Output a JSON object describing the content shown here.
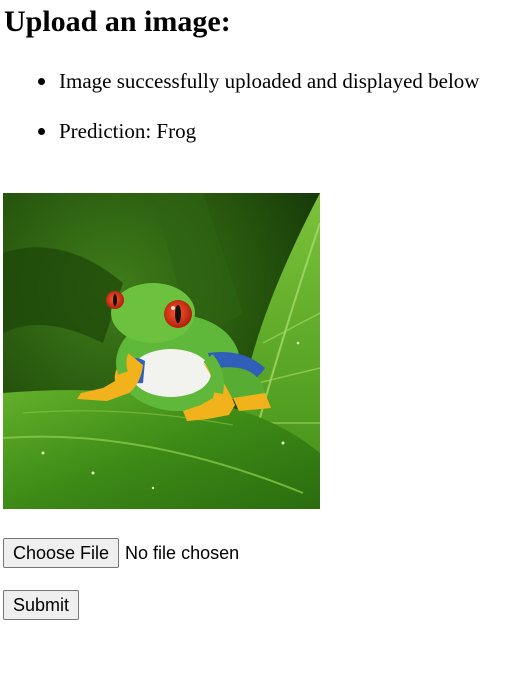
{
  "page": {
    "heading": "Upload an image:"
  },
  "messages": [
    "Image successfully uploaded and displayed below",
    "Prediction: Frog"
  ],
  "image": {
    "subject": "red-eyed tree frog on a green leaf"
  },
  "form": {
    "choose_file_label": "Choose File",
    "file_status": "No file chosen",
    "submit_label": "Submit"
  },
  "colors": {
    "leaf_dark": "#1e4a0c",
    "leaf_light": "#7cc33a",
    "frog_green": "#5fb83a",
    "frog_eye": "#d42a12",
    "frog_feet": "#f2b21c",
    "frog_blue": "#2f5fb8"
  }
}
